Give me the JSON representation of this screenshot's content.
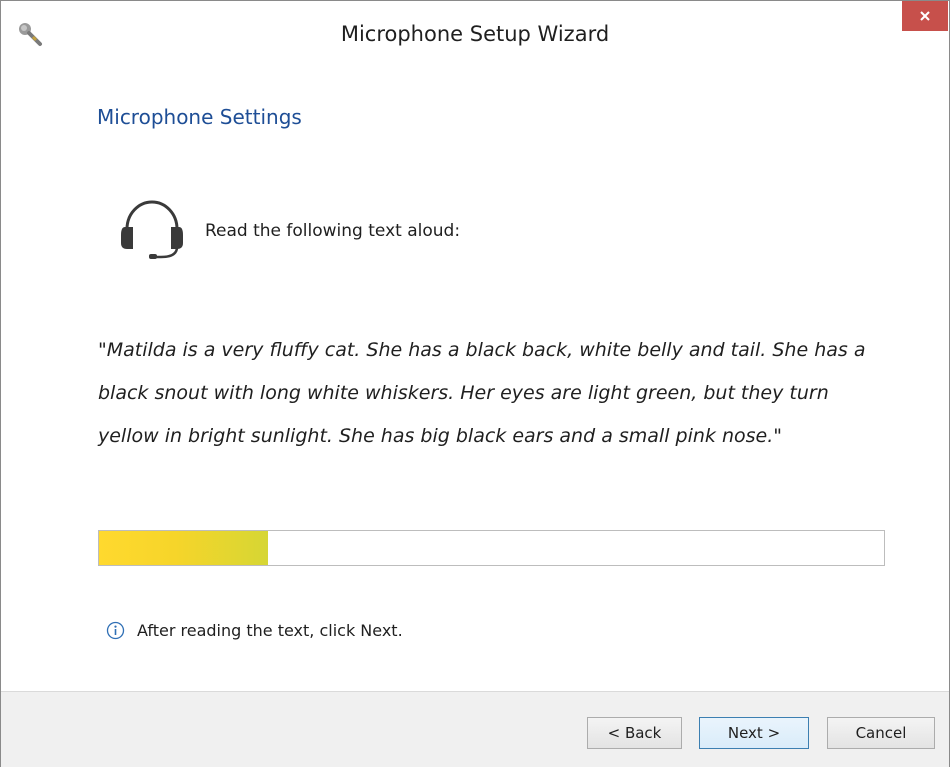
{
  "window": {
    "title": "Microphone Setup Wizard",
    "app_icon": "microphone-icon",
    "close_icon": "close-icon",
    "close_label": "×"
  },
  "main": {
    "heading": "Microphone Settings",
    "headset_icon": "headset-icon",
    "instruction": "Read the following text aloud:",
    "passage": "\"Matilda is a very fluffy cat. She has a black back, white belly and tail. She has a black snout with long white whiskers. Her eyes are light green, but they turn yellow in bright sunlight. She has big black ears and a small pink nose.\"",
    "level_meter": {
      "level_percent": 21.5
    },
    "hint": {
      "icon": "info-icon",
      "text": "After reading the text, click Next."
    }
  },
  "footer": {
    "back_label": "< Back",
    "next_label": "Next >",
    "cancel_label": "Cancel"
  },
  "colors": {
    "heading": "#1e4e96",
    "close_button": "#c7504b",
    "meter_fill_start": "#ffd92e",
    "meter_fill_end": "#d6d634",
    "footer_bg": "#f0f0f0"
  }
}
